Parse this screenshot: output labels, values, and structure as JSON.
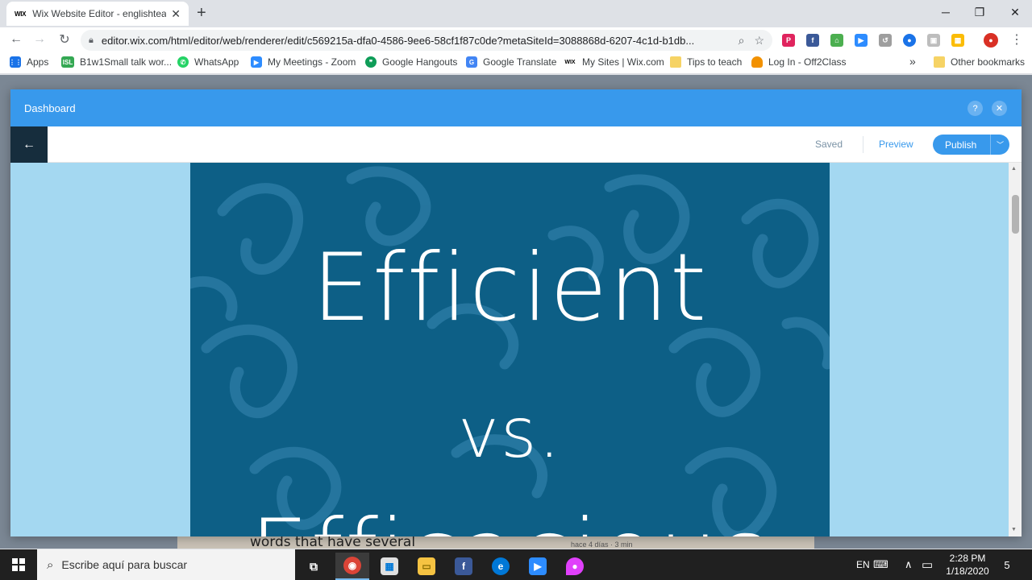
{
  "browser": {
    "tab_title": "Wix Website Editor - englishteac",
    "tab_favicon": "WIX",
    "url": "editor.wix.com/html/editor/web/renderer/edit/c569215a-dfa0-4586-9ee6-58cf1f87c0de?metaSiteId=3088868d-6207-4c1d-b1db...",
    "bookmarks": [
      {
        "label": "Apps",
        "icon": "apps-grid-icon",
        "color": "#1a73e8"
      },
      {
        "label": "B1w1Small talk wor...",
        "icon": "isl-icon",
        "color": "#34a853"
      },
      {
        "label": "WhatsApp",
        "icon": "whatsapp-icon",
        "color": "#25d366"
      },
      {
        "label": "My Meetings - Zoom",
        "icon": "zoom-icon",
        "color": "#2d8cff"
      },
      {
        "label": "Google Hangouts",
        "icon": "hangouts-icon",
        "color": "#0f9d58"
      },
      {
        "label": "Google Translate",
        "icon": "translate-icon",
        "color": "#4285f4"
      },
      {
        "label": "My Sites | Wix.com",
        "icon": "wix-icon",
        "color": "#000000"
      },
      {
        "label": "Tips to teach",
        "icon": "folder-icon",
        "color": "#f6c342"
      },
      {
        "label": "Log In - Off2Class",
        "icon": "off2class-icon",
        "color": "#f29100"
      }
    ],
    "overflow": "»",
    "other_bookmarks": "Other bookmarks"
  },
  "editor": {
    "modal_title": "Dashboard",
    "help": "?",
    "close": "✕",
    "back": "←",
    "saved": "Saved",
    "preview": "Preview",
    "publish": "Publish",
    "hero_words": [
      "Efficient",
      "vs.",
      "Efficacious"
    ]
  },
  "background_page": {
    "text": "words that have several",
    "meta": "hace 4 días · 3 min"
  },
  "taskbar": {
    "search_placeholder": "Escribe aquí para buscar",
    "language": "EN",
    "time": "2:28 PM",
    "date": "1/18/2020",
    "notification_count": "5"
  },
  "colors": {
    "wix_blue": "#3899ec",
    "hero_bg": "#0d5f86",
    "page_bg": "#a4d8f1",
    "dark_navy": "#162d3d"
  }
}
